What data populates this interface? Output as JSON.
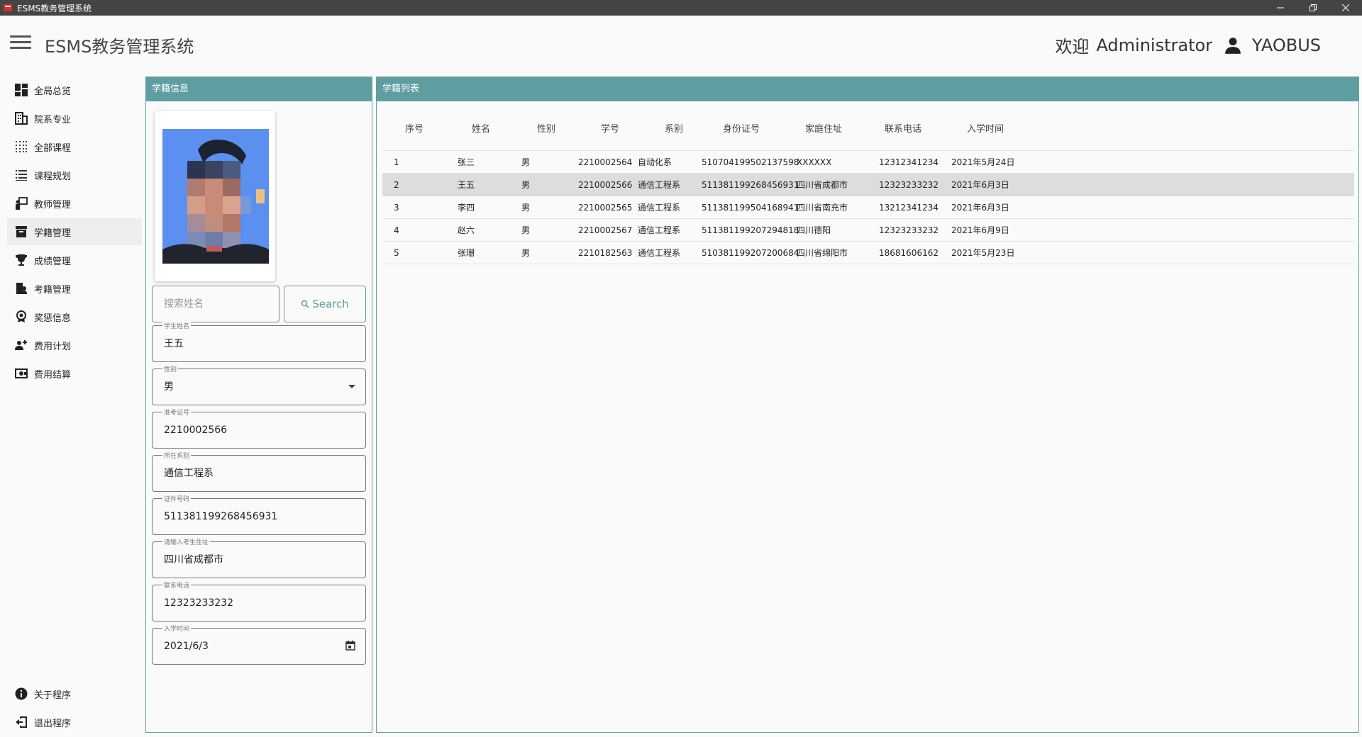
{
  "window": {
    "title": "ESMS教务管理系统"
  },
  "header": {
    "app_title": "ESMS教务管理系统",
    "welcome": "欢迎",
    "user_role": "Administrator",
    "username": "YAOBUS"
  },
  "sidebar": {
    "items": [
      {
        "label": "全局总览",
        "icon": "dashboard-icon"
      },
      {
        "label": "院系专业",
        "icon": "building-icon"
      },
      {
        "label": "全部课程",
        "icon": "grid-dots-icon"
      },
      {
        "label": "课程规划",
        "icon": "list-icon"
      },
      {
        "label": "教师管理",
        "icon": "teacher-icon"
      },
      {
        "label": "学籍管理",
        "icon": "archive-icon"
      },
      {
        "label": "成绩管理",
        "icon": "trophy-icon"
      },
      {
        "label": "考籍管理",
        "icon": "exam-icon"
      },
      {
        "label": "奖惩信息",
        "icon": "award-icon"
      },
      {
        "label": "费用计划",
        "icon": "fee-plan-icon"
      },
      {
        "label": "费用结算",
        "icon": "settlement-icon"
      }
    ],
    "active_index": 5,
    "bottom_items": [
      {
        "label": "关于程序",
        "icon": "info-icon"
      },
      {
        "label": "退出程序",
        "icon": "exit-icon"
      }
    ]
  },
  "student_info": {
    "panel_title": "学籍信息",
    "search_placeholder": "搜索姓名",
    "search_button": "Search",
    "fields": {
      "name": {
        "label": "学生姓名",
        "value": "王五"
      },
      "gender": {
        "label": "性别",
        "value": "男"
      },
      "exam_id": {
        "label": "准考证号",
        "value": "2210002566"
      },
      "department": {
        "label": "所在系别",
        "value": "通信工程系"
      },
      "id_number": {
        "label": "证件号码",
        "value": "511381199268456931"
      },
      "address": {
        "label": "请输入考生住址",
        "value": "四川省成都市"
      },
      "phone": {
        "label": "联系电话",
        "value": "12323233232"
      },
      "enroll_date": {
        "label": "入学时间",
        "value": "2021/6/3"
      }
    }
  },
  "student_list": {
    "panel_title": "学籍列表",
    "columns": [
      "序号",
      "姓名",
      "性别",
      "学号",
      "系别",
      "身份证号",
      "家庭住址",
      "联系电话",
      "入学时间"
    ],
    "rows": [
      [
        "1",
        "张三",
        "男",
        "2210002564",
        "自动化系",
        "510704199502137598",
        "XXXXXX",
        "12312341234",
        "2021年5月24日"
      ],
      [
        "2",
        "王五",
        "男",
        "2210002566",
        "通信工程系",
        "511381199268456931",
        "四川省成都市",
        "12323233232",
        "2021年6月3日"
      ],
      [
        "3",
        "李四",
        "男",
        "2210002565",
        "通信工程系",
        "511381199504168941",
        "四川省南充市",
        "13212341234",
        "2021年6月3日"
      ],
      [
        "4",
        "赵六",
        "男",
        "2210002567",
        "通信工程系",
        "511381199207294818",
        "四川德阳",
        "12323233232",
        "2021年6月9日"
      ],
      [
        "5",
        "张珊",
        "男",
        "2210182563",
        "通信工程系",
        "510381199207200684",
        "四川省绵阳市",
        "18681606162",
        "2021年5月23日"
      ]
    ],
    "selected_row": 1
  },
  "colors": {
    "accent": "#5f9ea0",
    "titlebar": "#444444",
    "selected_row": "#dddddd"
  }
}
